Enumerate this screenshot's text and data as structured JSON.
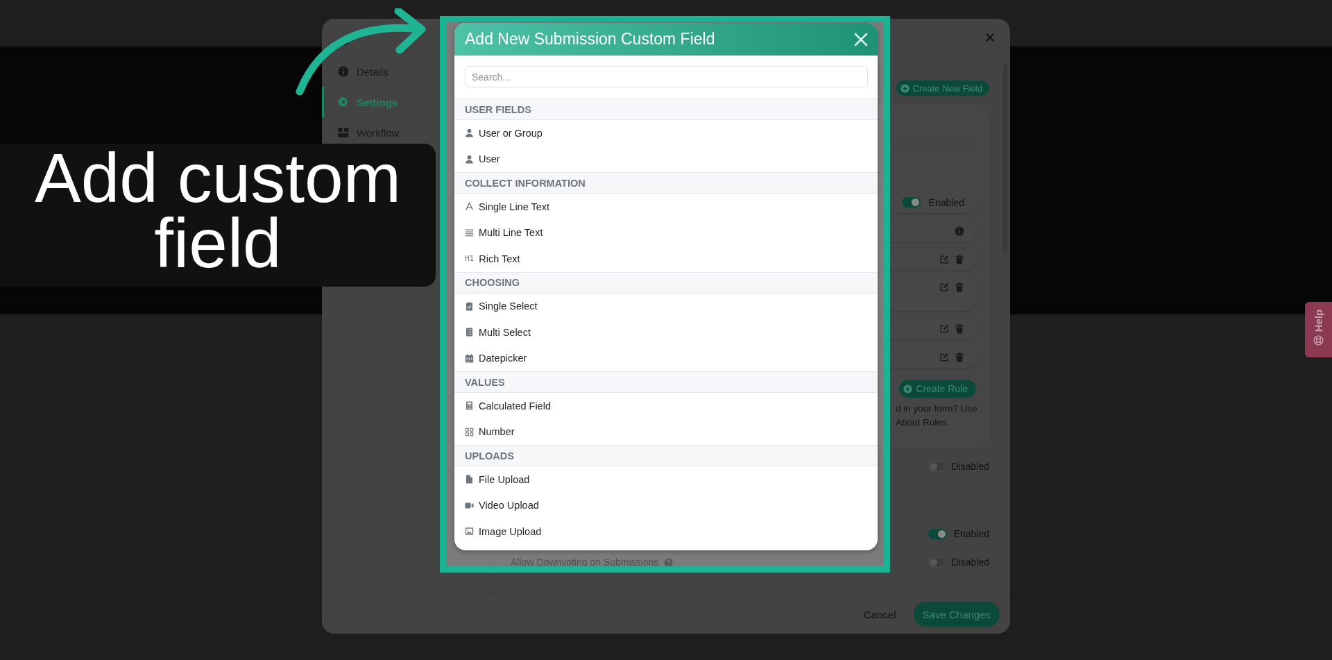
{
  "tutorial": {
    "caption": "Add custom field"
  },
  "settings_dialog": {
    "sidebar": [
      {
        "kind": "group",
        "selected": false
      },
      {
        "kind": "info",
        "label": "Details",
        "selected": false
      },
      {
        "kind": "settings",
        "label": "Settings",
        "selected": true
      },
      {
        "kind": "workflow",
        "label": "Workflow",
        "selected": false
      }
    ],
    "create_field_button": "Create New Field",
    "card_rows": [
      {
        "kind": "field"
      },
      {
        "kind": "toggle",
        "on": true,
        "state_label": "Enabled"
      },
      {
        "kind": "info"
      },
      {
        "kind": "actions"
      },
      {
        "kind": "actions"
      },
      {
        "kind": "actions"
      },
      {
        "kind": "actions"
      }
    ],
    "create_rule_button": "Create Rule",
    "rule_hint": [
      "d in your form? Use",
      "About Rules."
    ],
    "settings": [
      {
        "on": false,
        "state_label": "Disabled"
      },
      {
        "on": true,
        "state_label": "Enabled"
      },
      {
        "label": "Allow Downvoting on Submissions",
        "help": true,
        "on": false,
        "state_label": "Disabled"
      }
    ],
    "footer": {
      "cancel": "Cancel",
      "save": "Save Changes"
    }
  },
  "help_tab": "Help",
  "modal": {
    "title": "Add New Submission Custom Field",
    "search": {
      "placeholder": "Search..."
    },
    "groups": [
      {
        "heading": "USER FIELDS",
        "items": [
          {
            "label": "User or Group",
            "kind": "user"
          },
          {
            "label": "User",
            "kind": "user"
          }
        ]
      },
      {
        "heading": "COLLECT INFORMATION",
        "items": [
          {
            "label": "Single Line Text",
            "kind": "single-line"
          },
          {
            "label": "Multi Line Text",
            "kind": "multi-line"
          },
          {
            "label": "Rich Text",
            "kind": "rich-text",
            "glyph": "H1"
          }
        ]
      },
      {
        "heading": "CHOOSING",
        "items": [
          {
            "label": "Single Select",
            "kind": "single-select"
          },
          {
            "label": "Multi Select",
            "kind": "multi-select"
          },
          {
            "label": "Datepicker",
            "kind": "date"
          }
        ]
      },
      {
        "heading": "VALUES",
        "items": [
          {
            "label": "Calculated Field",
            "kind": "calculated"
          },
          {
            "label": "Number",
            "kind": "number"
          }
        ]
      },
      {
        "heading": "UPLOADS",
        "items": [
          {
            "label": "File Upload",
            "kind": "file"
          },
          {
            "label": "Video Upload",
            "kind": "video"
          },
          {
            "label": "Image Upload",
            "kind": "image"
          }
        ]
      }
    ]
  }
}
